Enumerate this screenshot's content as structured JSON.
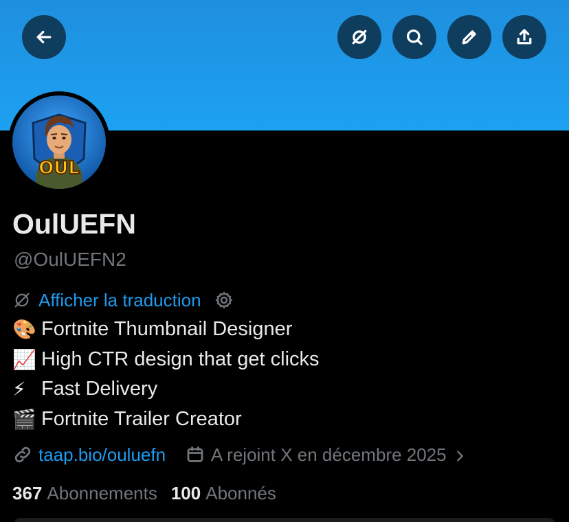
{
  "header": {
    "back_icon": "arrow-left-icon",
    "actions": [
      "translate-off-icon",
      "search-icon",
      "edit-pencil-icon",
      "share-upload-icon"
    ],
    "banner_color": "#1da1f2"
  },
  "profile": {
    "avatar_text": "OUL",
    "display_name": "OulUEFN",
    "handle": "@OulUEFN2",
    "translate_label": "Afficher la traduction",
    "bio": [
      {
        "emoji": "🎨",
        "text": "Fortnite Thumbnail Designer"
      },
      {
        "emoji": "📈",
        "text": "High CTR design that get clicks"
      },
      {
        "emoji": "⚡",
        "text": "Fast Delivery"
      },
      {
        "emoji": "🎬",
        "text": "Fortnite Trailer Creator"
      }
    ],
    "link": "taap.bio/ouluefn",
    "joined": "A rejoint X en décembre 2025",
    "following_count": "367",
    "following_label": "Abonnements",
    "followers_count": "100",
    "followers_label": "Abonnés"
  },
  "colors": {
    "accent": "#1d9bf0",
    "muted": "#71767b",
    "text": "#e7e9ea"
  }
}
